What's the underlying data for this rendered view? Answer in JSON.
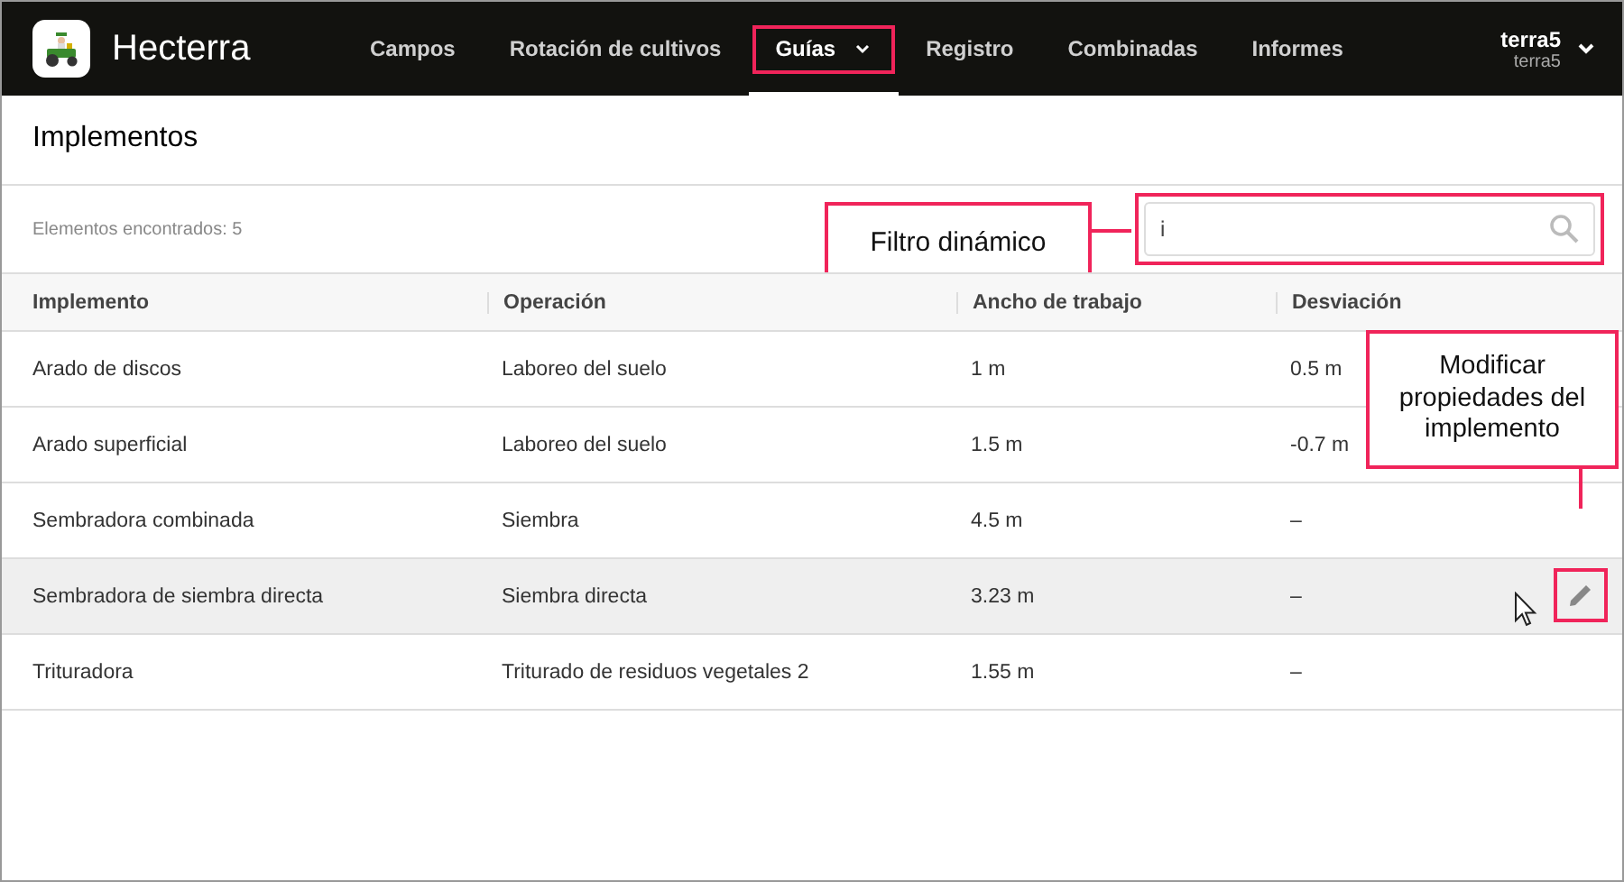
{
  "app": {
    "name": "Hecterra"
  },
  "nav": [
    {
      "label": "Campos",
      "selected": false,
      "dropdown": false
    },
    {
      "label": "Rotación de cultivos",
      "selected": false,
      "dropdown": false
    },
    {
      "label": "Guías",
      "selected": true,
      "dropdown": true
    },
    {
      "label": "Registro",
      "selected": false,
      "dropdown": false
    },
    {
      "label": "Combinadas",
      "selected": false,
      "dropdown": false
    },
    {
      "label": "Informes",
      "selected": false,
      "dropdown": false
    }
  ],
  "user": {
    "name": "terra5",
    "account": "terra5"
  },
  "page": {
    "title": "Implementos",
    "count": "Elementos encontrados: 5",
    "search": {
      "value": "i"
    }
  },
  "table": {
    "columns": [
      "Implemento",
      "Operación",
      "Ancho de trabajo",
      "Desviación"
    ],
    "rows": [
      {
        "cells": [
          "Arado de discos",
          "Laboreo del suelo",
          "1 m",
          "0.5 m"
        ],
        "hovered": false
      },
      {
        "cells": [
          "Arado superficial",
          "Laboreo del suelo",
          "1.5 m",
          "-0.7 m"
        ],
        "hovered": false
      },
      {
        "cells": [
          "Sembradora combinada",
          "Siembra",
          "4.5 m",
          "–"
        ],
        "hovered": false
      },
      {
        "cells": [
          "Sembradora de siembra directa",
          "Siembra directa",
          "3.23 m",
          "–"
        ],
        "hovered": true
      },
      {
        "cells": [
          "Trituradora",
          "Triturado de residuos vegetales 2",
          "1.55 m",
          "–"
        ],
        "hovered": false
      }
    ]
  },
  "callouts": [
    {
      "kind": "search",
      "text": "Filtro dinámico"
    },
    {
      "kind": "edit",
      "text": "Modificar propiedades del implemento"
    }
  ]
}
